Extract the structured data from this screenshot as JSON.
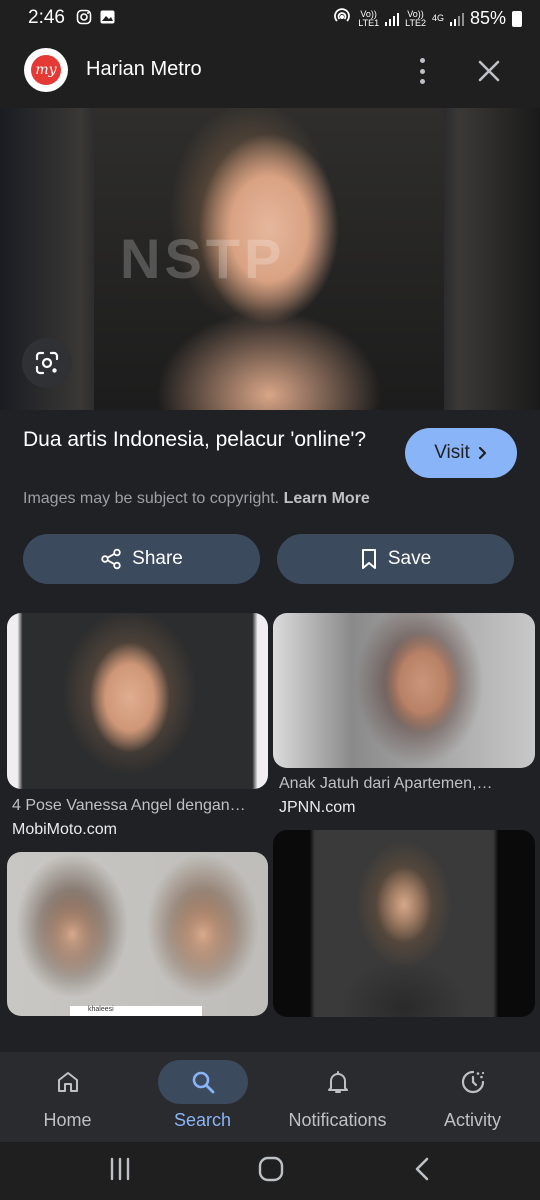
{
  "status_bar": {
    "time": "2:46",
    "sim1": "LTE1",
    "sim2": "LTE2",
    "vol": "Vo))",
    "net": "4G",
    "battery": "85%"
  },
  "header": {
    "logo_text": "my",
    "site_name": "Harian Metro"
  },
  "image": {
    "watermark": "NSTP"
  },
  "result": {
    "title": "Dua artis Indonesia, pelacur 'online'?",
    "visit_label": "Visit",
    "copyright_text": "Images may be subject to copyright.",
    "learn_more": "Learn More"
  },
  "actions": {
    "share_label": "Share",
    "save_label": "Save"
  },
  "related": [
    {
      "caption": "4 Pose Vanessa Angel dengan…",
      "source": "MobiMoto.com"
    },
    {
      "caption": "Anak Jatuh dari Apartemen,…",
      "source": "JPNN.com"
    },
    {
      "overlay": "khaleesi"
    }
  ],
  "bottom_nav": {
    "items": [
      {
        "label": "Home",
        "icon": "home-icon"
      },
      {
        "label": "Search",
        "icon": "search-icon",
        "active": true
      },
      {
        "label": "Notifications",
        "icon": "bell-icon"
      },
      {
        "label": "Activity",
        "icon": "activity-icon"
      }
    ]
  },
  "colors": {
    "background": "#202124",
    "accent": "#8ab4f8",
    "pill": "#3c4a5e"
  }
}
